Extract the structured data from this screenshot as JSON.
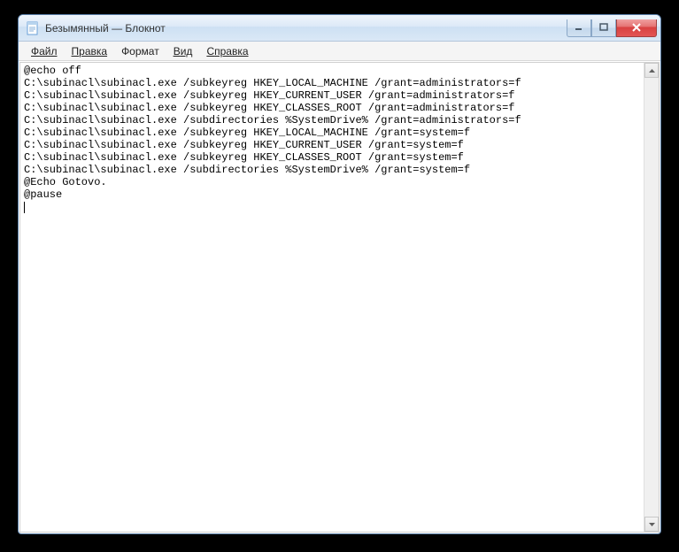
{
  "window": {
    "title": "Безымянный — Блокнот"
  },
  "menu": {
    "file": "Файл",
    "edit": "Правка",
    "format": "Формат",
    "view": "Вид",
    "help": "Справка"
  },
  "content": {
    "lines": [
      "@echo off",
      "C:\\subinacl\\subinacl.exe /subkeyreg HKEY_LOCAL_MACHINE /grant=administrators=f",
      "C:\\subinacl\\subinacl.exe /subkeyreg HKEY_CURRENT_USER /grant=administrators=f",
      "C:\\subinacl\\subinacl.exe /subkeyreg HKEY_CLASSES_ROOT /grant=administrators=f",
      "C:\\subinacl\\subinacl.exe /subdirectories %SystemDrive% /grant=administrators=f",
      "C:\\subinacl\\subinacl.exe /subkeyreg HKEY_LOCAL_MACHINE /grant=system=f",
      "C:\\subinacl\\subinacl.exe /subkeyreg HKEY_CURRENT_USER /grant=system=f",
      "C:\\subinacl\\subinacl.exe /subkeyreg HKEY_CLASSES_ROOT /grant=system=f",
      "C:\\subinacl\\subinacl.exe /subdirectories %SystemDrive% /grant=system=f",
      "@Echo Gotovo.",
      "@pause"
    ]
  }
}
